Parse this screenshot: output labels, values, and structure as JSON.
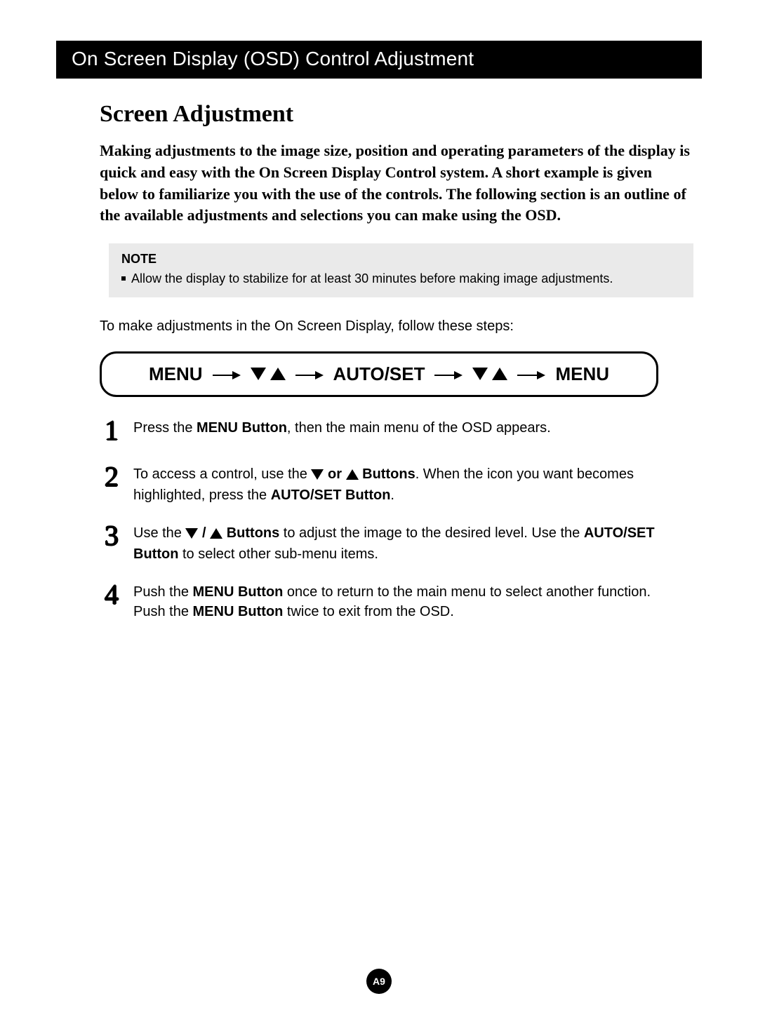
{
  "titleBar": "On Screen Display (OSD) Control Adjustment",
  "sectionHeading": "Screen Adjustment",
  "intro": "Making adjustments to the image size, position and operating parameters of the display is quick and easy with the On Screen Display Control system. A short example is given below to familiarize you with the use of the controls. The following section is an outline of the available adjustments and selections you can make using the OSD.",
  "note": {
    "label": "NOTE",
    "item": "Allow the display to stabilize for at least 30 minutes before making image adjustments."
  },
  "followSteps": "To make adjustments in the On Screen Display, follow these steps:",
  "flow": {
    "menu1": "MENU",
    "autoSet": "AUTO/SET",
    "menu2": "MENU"
  },
  "steps": {
    "s1": {
      "num": "1",
      "pre": "Press the ",
      "b1": "MENU Button",
      "post": ", then the main menu of the OSD appears."
    },
    "s2": {
      "num": "2",
      "pre": "To access a control, use the ",
      "mid1": " or ",
      "b1": " Buttons",
      "post1": ". When the icon you want becomes highlighted, press the ",
      "b2": "AUTO/SET Button",
      "post2": "."
    },
    "s3": {
      "num": "3",
      "pre": "Use the  ",
      "sep": " / ",
      "b1": " Buttons",
      "post1": " to adjust the image to the desired level. Use the ",
      "b2": "AUTO/SET Button",
      "post2": " to select other sub-menu items."
    },
    "s4": {
      "num": "4",
      "pre": "Push the ",
      "b1": "MENU Button",
      "mid": " once to return to the main menu to select another function. Push the ",
      "b2": "MENU Button",
      "post": " twice to exit from the OSD."
    }
  },
  "pageNumber": "A9"
}
